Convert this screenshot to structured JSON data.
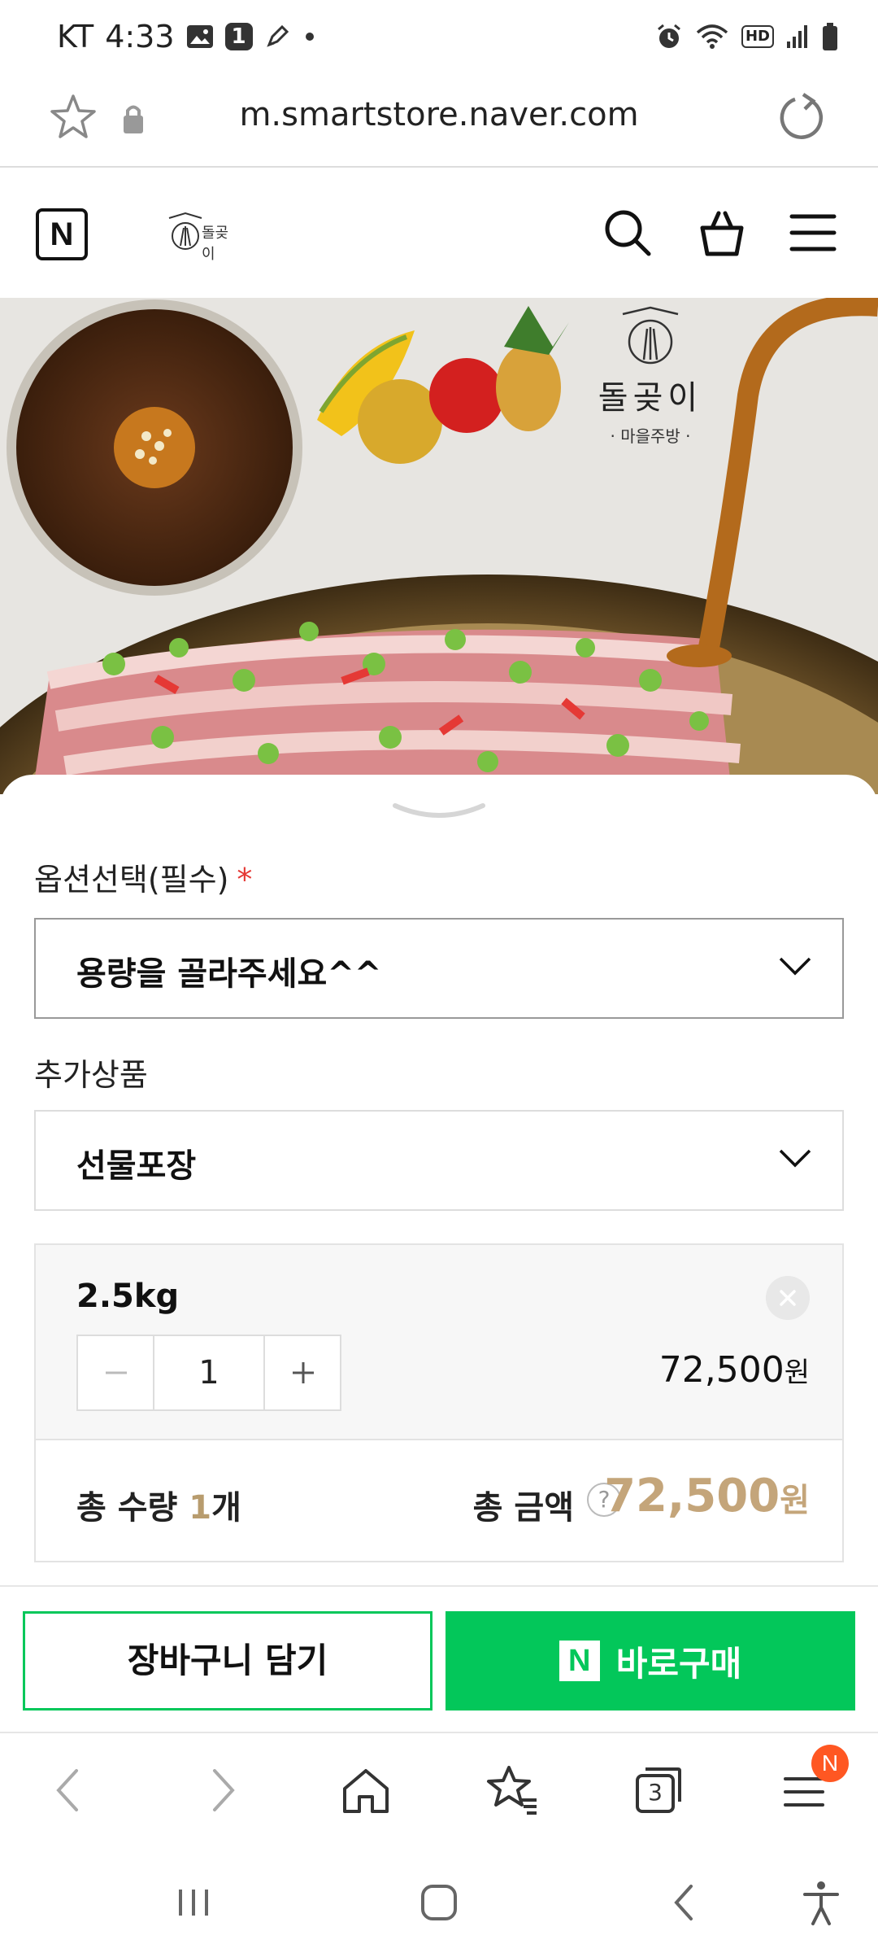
{
  "status_bar": {
    "carrier": "KT",
    "time": "4:33",
    "notif_badge": "1",
    "network_label": "HD",
    "icons": [
      "image-icon",
      "badge-icon",
      "pen-icon",
      "dot-icon",
      "alarm-icon",
      "wifi-icon",
      "hd-icon",
      "signal-icon",
      "battery-icon"
    ]
  },
  "browser": {
    "url": "m.smartstore.naver.com",
    "icons": [
      "star-icon",
      "lock-icon",
      "reload-icon"
    ]
  },
  "header": {
    "naver_logo": "N",
    "store_logo_text": "돌곶이",
    "icons": [
      "search-icon",
      "cart-icon",
      "menu-icon"
    ]
  },
  "hero": {
    "brand_name": "돌곶이",
    "brand_sub": "· 마을주방 ·"
  },
  "options": {
    "label": "옵션선택(필수)",
    "required_mark": "*",
    "select_placeholder": "용량을 골라주세요^^",
    "additional_label": "추가상품",
    "additional_value": "선물포장"
  },
  "selected_item": {
    "name": "2.5kg",
    "quantity": "1",
    "price": "72,500",
    "currency": "원"
  },
  "totals": {
    "qty_prefix": "총 수량 ",
    "qty_value": "1",
    "qty_suffix": "개",
    "amount_label": "총 금액",
    "help": "?",
    "amount": "72,500",
    "currency": "원"
  },
  "actions": {
    "cart_label": "장바구니 담기",
    "buy_label": "바로구매",
    "buy_logo": "N"
  },
  "bottom_nav": {
    "tabs_count": "3",
    "menu_badge": "N",
    "icons": [
      "back-icon",
      "forward-icon",
      "home-icon",
      "bookmarks-icon",
      "tabs-icon",
      "menu-icon"
    ]
  },
  "system_nav": {
    "icons": [
      "recents-icon",
      "home-button-icon",
      "back-icon",
      "accessibility-icon"
    ]
  },
  "colors": {
    "naver_green": "#03c75a",
    "price_gold": "#c4a57a",
    "required_red": "#e53935",
    "badge_orange": "#ff5722"
  }
}
